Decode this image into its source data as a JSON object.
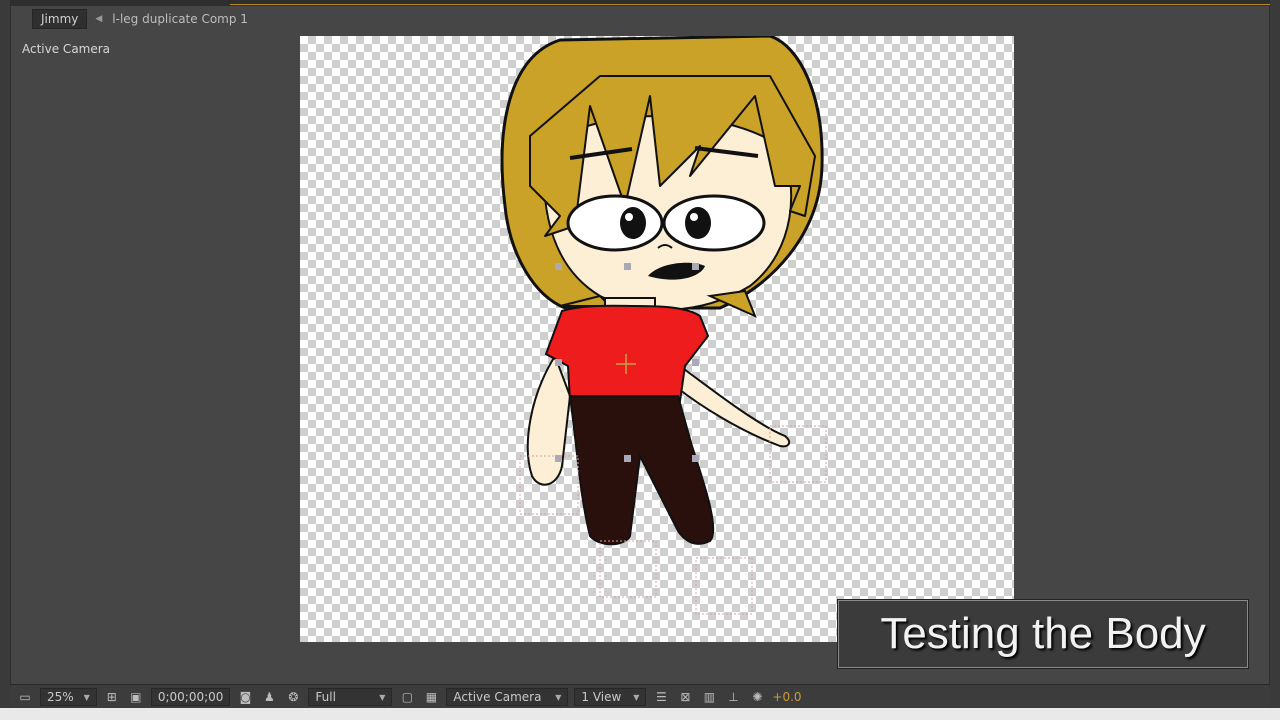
{
  "comp_panel": {
    "active_tab": "Jimmy",
    "other_tab": "l-leg duplicate Comp 1",
    "view_label": "Active Camera"
  },
  "caption": "Testing the Body",
  "toolbar": {
    "magnification": "25%",
    "timecode": "0;00;00;00",
    "resolution": "Full",
    "camera": "Active Camera",
    "views": "1 View",
    "exposure": "+0.0"
  },
  "icons": [
    "monitor-icon",
    "grid-icon",
    "mask-icon",
    "camera-snapshot-icon",
    "show-snapshot-icon",
    "color-channels-icon",
    "region-of-interest-icon",
    "transparency-grid-icon",
    "layout-icon",
    "pixel-aspect-icon",
    "fast-preview-icon",
    "flowchart-icon",
    "reset-exposure-icon"
  ],
  "colors": {
    "hair": "#c9a227",
    "skin": "#fdeed6",
    "shirt": "#ee1c1c",
    "pants": "#2a100c",
    "accent": "#c99a3a"
  }
}
